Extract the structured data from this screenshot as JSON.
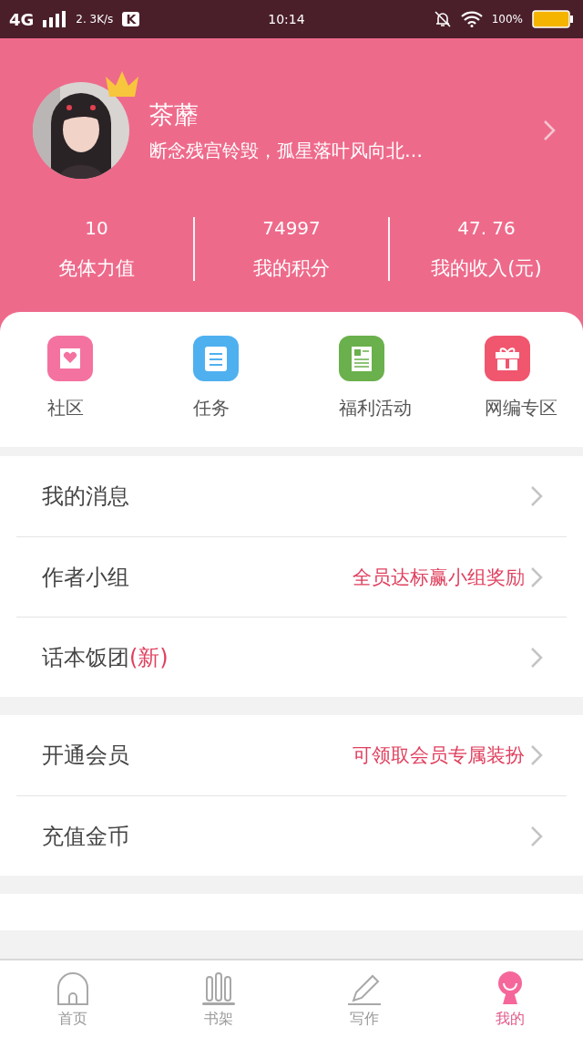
{
  "status_bar": {
    "network": "4G",
    "speed": "2. 3K/s",
    "app_badge": "K",
    "time": "10:14",
    "battery": "100%"
  },
  "profile": {
    "name": "茶蘼",
    "motto": "断念残宫铃毁，孤星落叶风向北…"
  },
  "stats": [
    {
      "value": "10",
      "label": "免体力值"
    },
    {
      "value": "74997",
      "label": "我的积分"
    },
    {
      "value": "47. 76",
      "label": "我的收入(元)"
    }
  ],
  "shortcuts": [
    {
      "kind": "community",
      "label": "社区",
      "color": "#f472a0"
    },
    {
      "kind": "task",
      "label": "任务",
      "color": "#4fb0f0"
    },
    {
      "kind": "welfare",
      "label": "福利活动",
      "color": "#6ab04c"
    },
    {
      "kind": "gift",
      "label": "网编专区",
      "color": "#f0566e"
    }
  ],
  "menu_groups": [
    [
      {
        "label": "我的消息"
      },
      {
        "label": "作者小组",
        "note": "全员达标赢小组奖励"
      },
      {
        "label": "话本饭团",
        "tag": "(新)"
      }
    ],
    [
      {
        "label": "开通会员",
        "note": "可领取会员专属装扮"
      },
      {
        "label": "充值金币"
      }
    ]
  ],
  "tabs": [
    {
      "kind": "home",
      "label": "首页",
      "selected": false
    },
    {
      "kind": "shelf",
      "label": "书架",
      "selected": false
    },
    {
      "kind": "write",
      "label": "写作",
      "selected": false
    },
    {
      "kind": "me",
      "label": "我的",
      "selected": true
    }
  ]
}
